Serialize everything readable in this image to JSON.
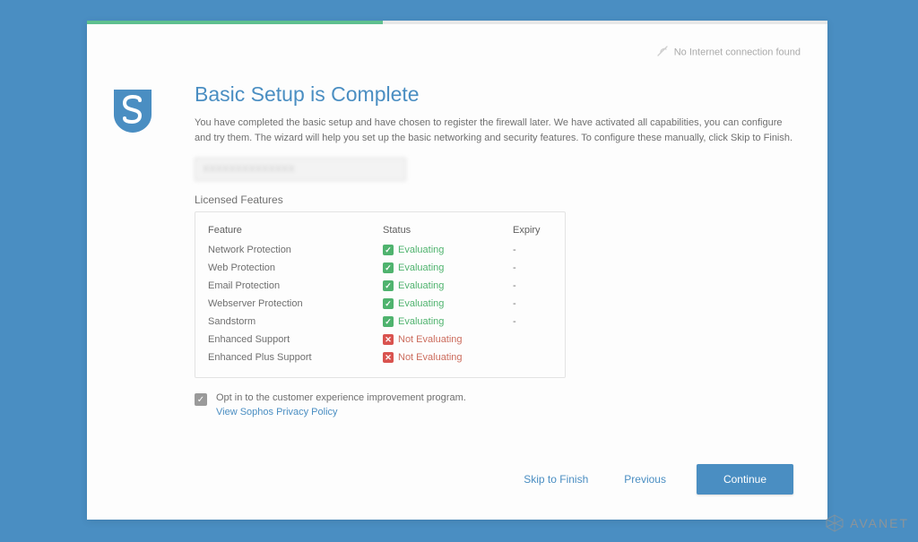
{
  "topbar": {
    "connection_status": "No Internet connection found"
  },
  "heading": {
    "title": "Basic Setup is Complete",
    "description": "You have completed the basic setup and have chosen to register the firewall later. We have activated all capabilities, you can configure and try them. The wizard will help you set up the basic networking and security features. To configure these manually, click Skip to Finish."
  },
  "license_input_value": "XXXXXXXXXXXXXX",
  "licensed_features": {
    "label": "Licensed Features",
    "cols": {
      "feature": "Feature",
      "status": "Status",
      "expiry": "Expiry"
    },
    "rows": [
      {
        "feature": "Network Protection",
        "status": "Evaluating",
        "ok": true,
        "expiry": "-"
      },
      {
        "feature": "Web Protection",
        "status": "Evaluating",
        "ok": true,
        "expiry": "-"
      },
      {
        "feature": "Email Protection",
        "status": "Evaluating",
        "ok": true,
        "expiry": "-"
      },
      {
        "feature": "Webserver Protection",
        "status": "Evaluating",
        "ok": true,
        "expiry": "-"
      },
      {
        "feature": "Sandstorm",
        "status": "Evaluating",
        "ok": true,
        "expiry": "-"
      },
      {
        "feature": "Enhanced Support",
        "status": "Not Evaluating",
        "ok": false,
        "expiry": ""
      },
      {
        "feature": "Enhanced Plus Support",
        "status": "Not Evaluating",
        "ok": false,
        "expiry": ""
      }
    ]
  },
  "optin": {
    "checked": true,
    "label": "Opt in to the customer experience improvement program.",
    "policy_link": "View Sophos Privacy Policy"
  },
  "footer": {
    "skip": "Skip to Finish",
    "previous": "Previous",
    "continue": "Continue"
  },
  "watermark": "AVANET"
}
